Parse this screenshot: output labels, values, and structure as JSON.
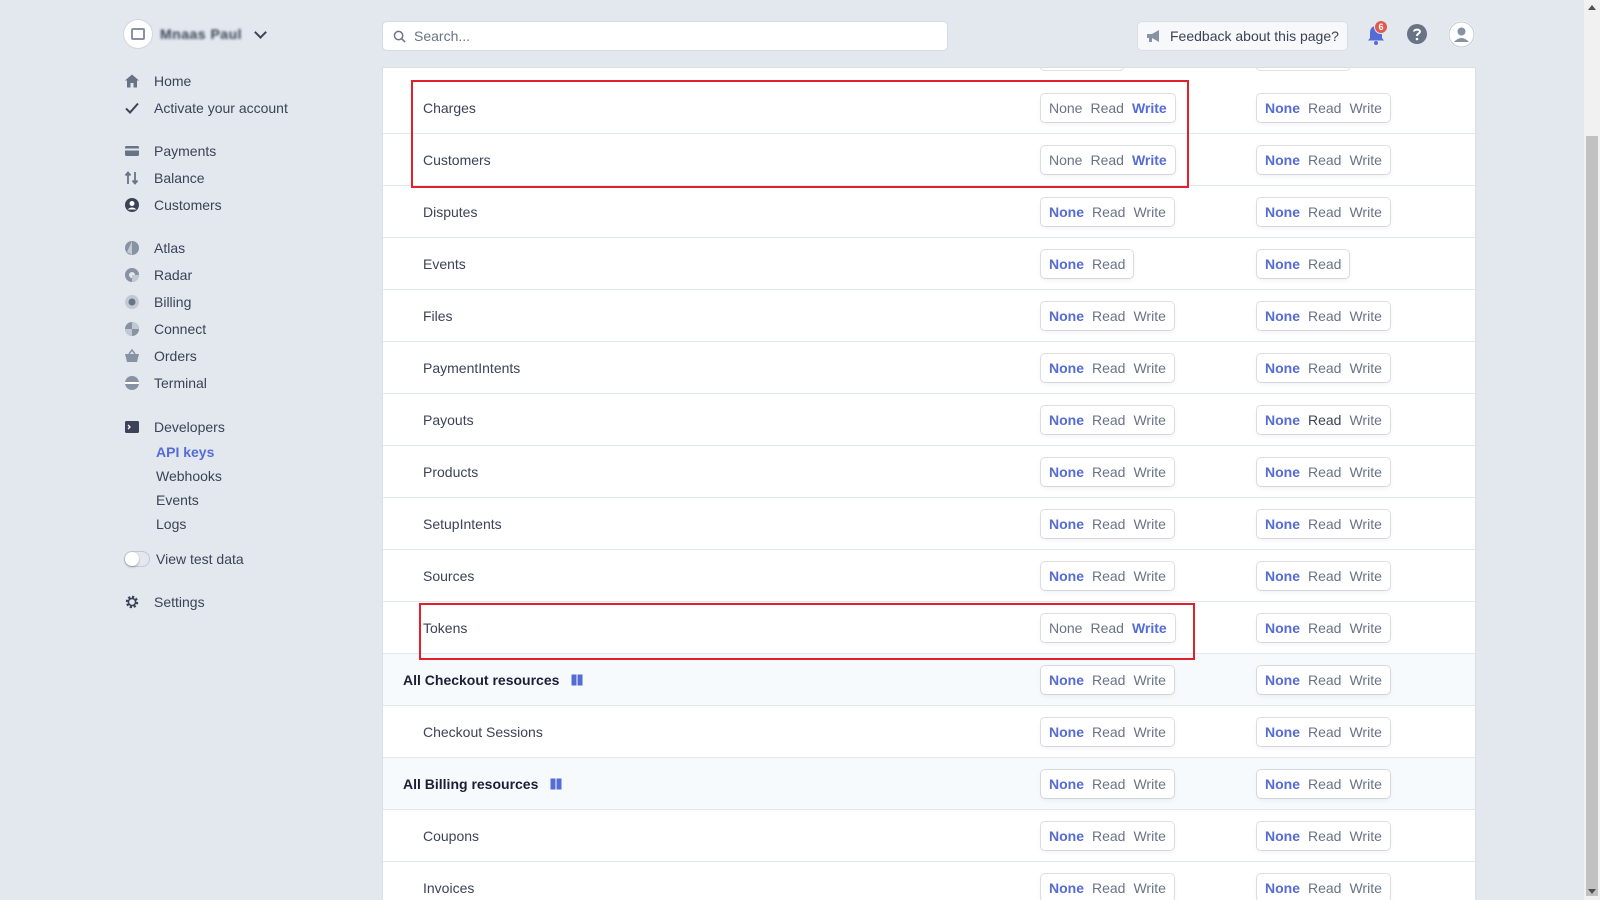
{
  "account": {
    "name": "Mnaas Paul"
  },
  "sidebar": {
    "items": [
      {
        "label": "Home",
        "icon": "home-icon"
      },
      {
        "label": "Activate your account",
        "icon": "check-icon"
      },
      {
        "label": "Payments",
        "icon": "payments-icon"
      },
      {
        "label": "Balance",
        "icon": "balance-icon"
      },
      {
        "label": "Customers",
        "icon": "customers-icon"
      },
      {
        "label": "Atlas",
        "icon": "atlas-icon"
      },
      {
        "label": "Radar",
        "icon": "radar-icon"
      },
      {
        "label": "Billing",
        "icon": "billing-icon"
      },
      {
        "label": "Connect",
        "icon": "connect-icon"
      },
      {
        "label": "Orders",
        "icon": "orders-icon"
      },
      {
        "label": "Terminal",
        "icon": "terminal-icon"
      },
      {
        "label": "Developers",
        "icon": "developers-icon"
      }
    ],
    "developers_sub": [
      "API keys",
      "Webhooks",
      "Events",
      "Logs"
    ],
    "view_test_data": "View test data",
    "settings": "Settings"
  },
  "header": {
    "search_placeholder": "Search...",
    "feedback": "Feedback about this page?",
    "notifications_count": "6"
  },
  "permissions": {
    "labels": {
      "none": "None",
      "read": "Read",
      "write": "Write"
    },
    "rows": [
      {
        "name": "Charges",
        "group": false,
        "col1": "Write",
        "col2": "None",
        "has_write": true
      },
      {
        "name": "Customers",
        "group": false,
        "col1": "Write",
        "col2": "None",
        "has_write": true
      },
      {
        "name": "Disputes",
        "group": false,
        "col1": "None",
        "col2": "None",
        "has_write": true
      },
      {
        "name": "Events",
        "group": false,
        "col1": "None",
        "col2": "None",
        "has_write": false
      },
      {
        "name": "Files",
        "group": false,
        "col1": "None",
        "col2": "None",
        "has_write": true
      },
      {
        "name": "PaymentIntents",
        "group": false,
        "col1": "None",
        "col2": "None",
        "has_write": true
      },
      {
        "name": "Payouts",
        "group": false,
        "col1": "None",
        "col2": "None",
        "has_write": true
      },
      {
        "name": "Products",
        "group": false,
        "col1": "None",
        "col2": "None",
        "has_write": true
      },
      {
        "name": "SetupIntents",
        "group": false,
        "col1": "None",
        "col2": "None",
        "has_write": true
      },
      {
        "name": "Sources",
        "group": false,
        "col1": "None",
        "col2": "None",
        "has_write": true
      },
      {
        "name": "Tokens",
        "group": false,
        "col1": "Write",
        "col2": "None",
        "has_write": true
      },
      {
        "name": "All Checkout resources",
        "group": true,
        "col1": "None",
        "col2": "None",
        "has_write": true
      },
      {
        "name": "Checkout Sessions",
        "group": false,
        "col1": "None",
        "col2": "None",
        "has_write": true
      },
      {
        "name": "All Billing resources",
        "group": true,
        "col1": "None",
        "col2": "None",
        "has_write": true
      },
      {
        "name": "Coupons",
        "group": false,
        "col1": "None",
        "col2": "None",
        "has_write": true
      },
      {
        "name": "Invoices",
        "group": false,
        "col1": "None",
        "col2": "None",
        "has_write": true
      }
    ]
  },
  "colors": {
    "accent": "#556cd6",
    "highlight": "#e0202a",
    "badge": "#e25950"
  }
}
